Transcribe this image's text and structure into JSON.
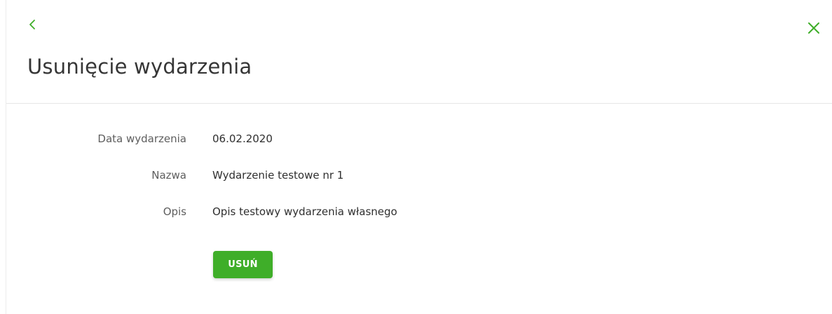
{
  "header": {
    "title": "Usunięcie wydarzenia",
    "back_icon": "chevron-left-icon",
    "close_icon": "close-icon"
  },
  "details": [
    {
      "label": "Data wydarzenia",
      "value": "06.02.2020"
    },
    {
      "label": "Nazwa",
      "value": "Wydarzenie testowe nr 1"
    },
    {
      "label": "Opis",
      "value": "Opis testowy wydarzenia własnego"
    }
  ],
  "actions": {
    "delete_label": "USUŃ"
  },
  "colors": {
    "accent": "#3fae29",
    "title": "#363636",
    "label": "#5e5e5e",
    "value": "#2f2f2f"
  }
}
